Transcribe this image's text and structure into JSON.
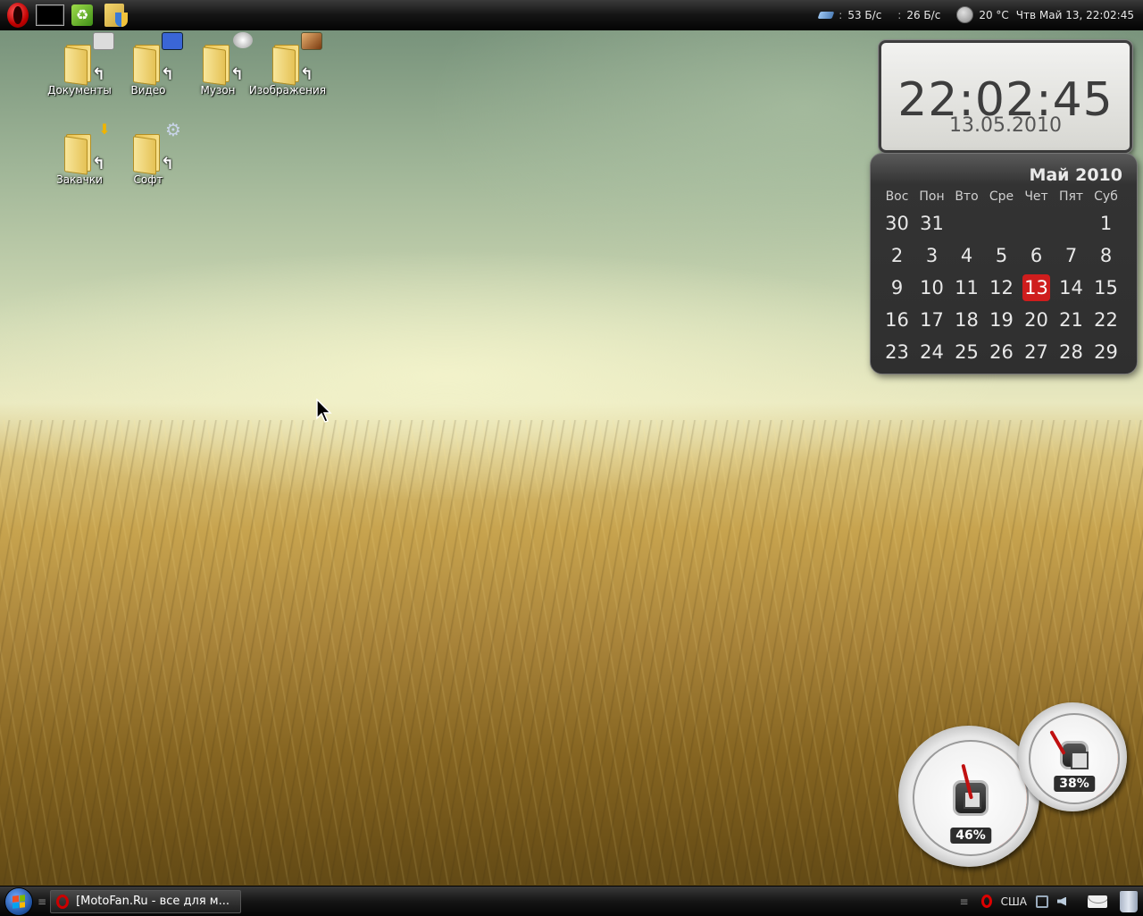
{
  "top_panel": {
    "launchers": [
      {
        "name": "opera-icon"
      },
      {
        "name": "terminal-icon"
      },
      {
        "name": "recycle-icon"
      },
      {
        "name": "shield-icon"
      }
    ],
    "net_down": "53 Б/с",
    "net_up": "26 Б/с",
    "weather": "20 °C",
    "datetime": "Чтв Май 13, 22:02:45"
  },
  "desktop_icons": [
    {
      "label": "Документы",
      "badge_color": "#d9d9d9"
    },
    {
      "label": "Видео",
      "badge_color": "#3a66d6"
    },
    {
      "label": "Музон",
      "badge_color": "#bdbdbd"
    },
    {
      "label": "Изображения",
      "badge_color": "#b3662a"
    },
    {
      "label": "Закачки",
      "badge_color": "#f0b400"
    },
    {
      "label": "Софт",
      "badge_color": "#8aa0c8"
    }
  ],
  "clock": {
    "time": "22:02:45",
    "date": "13.05.2010"
  },
  "calendar": {
    "month_year": "Май 2010",
    "weekdays": [
      "Вос",
      "Пон",
      "Вто",
      "Сре",
      "Чет",
      "Пят",
      "Суб"
    ],
    "weeks": [
      [
        "30",
        "31",
        "",
        "",
        "",
        "",
        "1"
      ],
      [
        "2",
        "3",
        "4",
        "5",
        "6",
        "7",
        "8"
      ],
      [
        "9",
        "10",
        "11",
        "12",
        "13",
        "14",
        "15"
      ],
      [
        "16",
        "17",
        "18",
        "19",
        "20",
        "21",
        "22"
      ],
      [
        "23",
        "24",
        "25",
        "26",
        "27",
        "28",
        "29"
      ]
    ],
    "today": "13"
  },
  "gauges": {
    "cpu_percent": "46%",
    "memory_percent": "38%"
  },
  "taskbar": {
    "window_title": "[MotoFan.Ru - все для м...",
    "keyboard_layout": "США"
  },
  "colors": {
    "today_highlight": "#cf1d1d",
    "gauge_needle": "#c01010"
  }
}
